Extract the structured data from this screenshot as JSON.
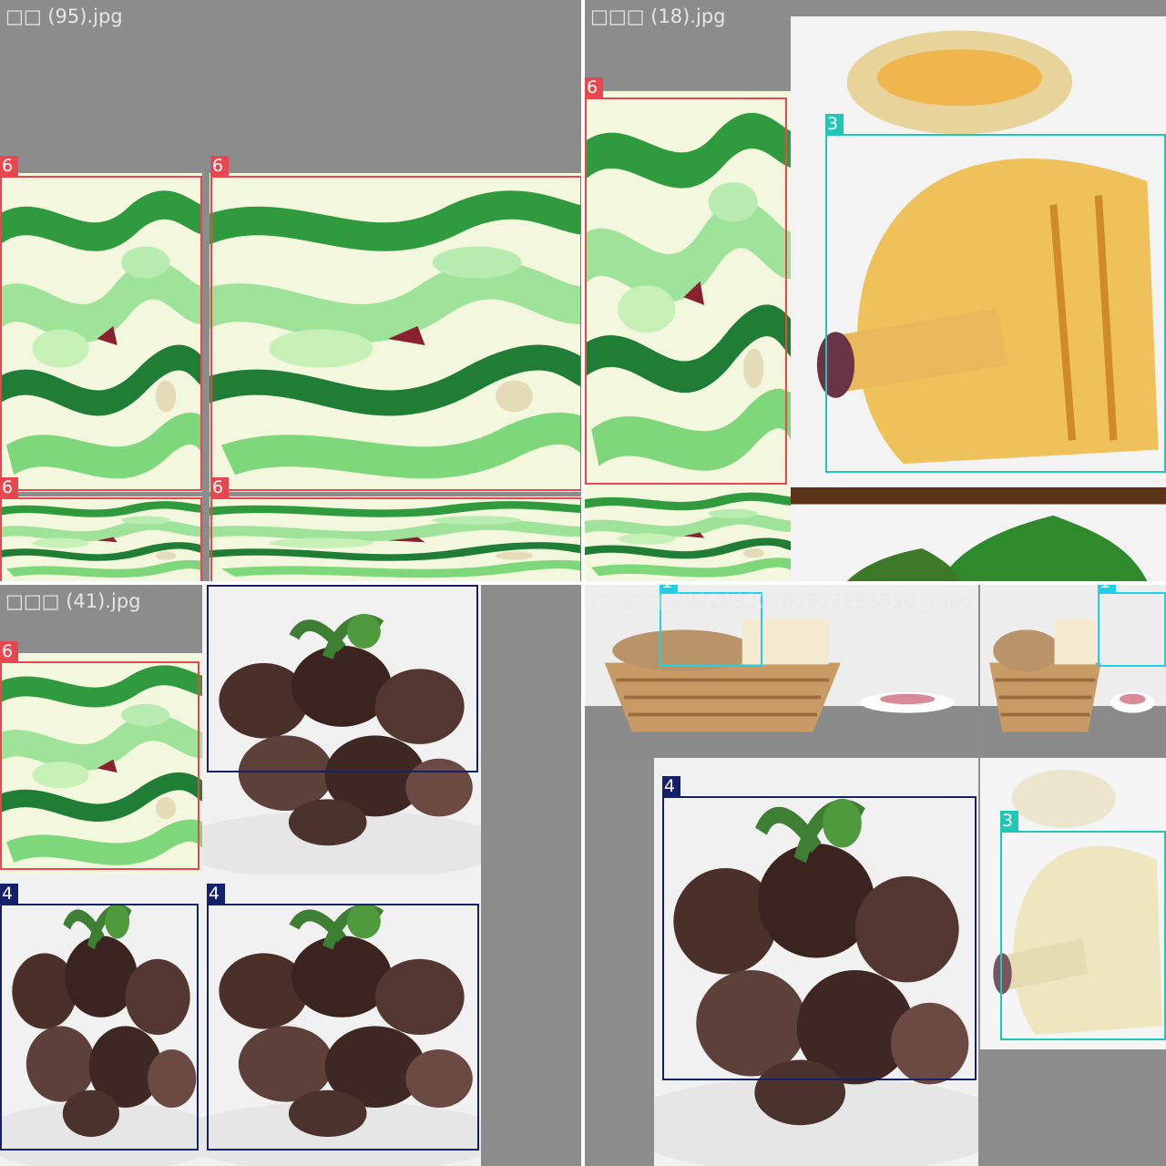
{
  "mosaics": [
    {
      "filename": "□□ (95).jpg"
    },
    {
      "filename": "□□□ (18).jpg"
    },
    {
      "filename": "□□□ (41).jpg"
    },
    {
      "filename": "□□□□_20220930160012893050_1.jpg"
    }
  ],
  "class_colors": {
    "1": "#1fd1e6",
    "3": "#20c7b4",
    "4": "#15206a",
    "6": "#e8474f"
  },
  "detections": [
    {
      "mosaic": 0,
      "class_id": "6"
    },
    {
      "mosaic": 0,
      "class_id": "6"
    },
    {
      "mosaic": 0,
      "class_id": "6"
    },
    {
      "mosaic": 0,
      "class_id": "6"
    },
    {
      "mosaic": 1,
      "class_id": "6"
    },
    {
      "mosaic": 1,
      "class_id": "3"
    },
    {
      "mosaic": 2,
      "class_id": "6"
    },
    {
      "mosaic": 2,
      "class_id": "4"
    },
    {
      "mosaic": 2,
      "class_id": "4"
    },
    {
      "mosaic": 2,
      "class_id": "4"
    },
    {
      "mosaic": 3,
      "class_id": "1"
    },
    {
      "mosaic": 3,
      "class_id": "1"
    },
    {
      "mosaic": 3,
      "class_id": "4"
    },
    {
      "mosaic": 3,
      "class_id": "3"
    }
  ]
}
